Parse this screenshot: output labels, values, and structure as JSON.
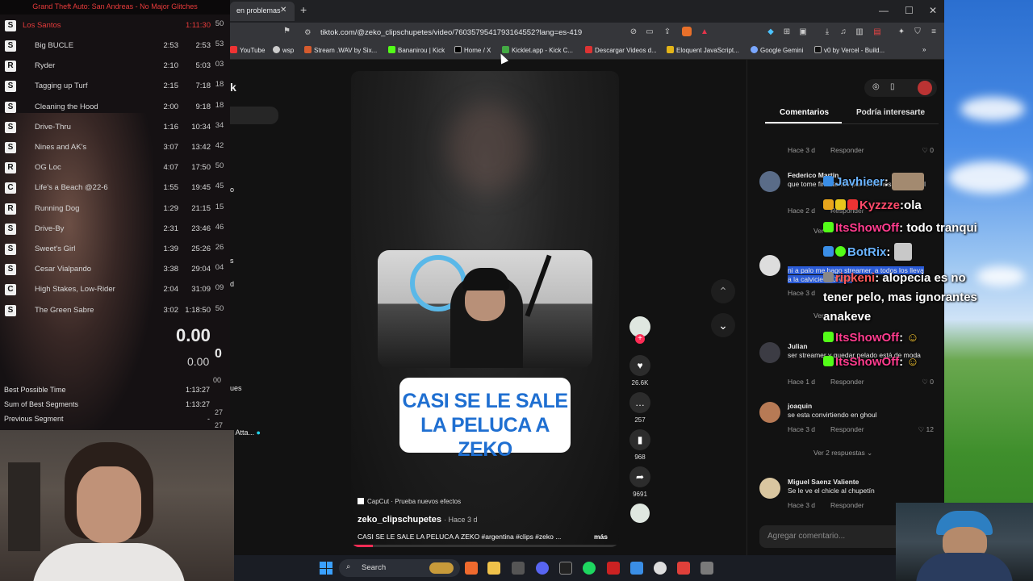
{
  "livesplit": {
    "title": "Grand Theft Auto: San Andreas - No Major Glitches",
    "current": {
      "label": "Los Santos",
      "time": "1:11:30",
      "extra": "50"
    },
    "splits": [
      {
        "icon": "S",
        "name": "Big BUCLE",
        "delta": "2:53",
        "time": "2:53",
        "extra": "53"
      },
      {
        "icon": "R",
        "name": "Ryder",
        "delta": "2:10",
        "time": "5:03",
        "extra": "03"
      },
      {
        "icon": "S",
        "name": "Tagging up Turf",
        "delta": "2:15",
        "time": "7:18",
        "extra": "18"
      },
      {
        "icon": "S",
        "name": "Cleaning the Hood",
        "delta": "2:00",
        "time": "9:18",
        "extra": "18"
      },
      {
        "icon": "S",
        "name": "Drive-Thru",
        "delta": "1:16",
        "time": "10:34",
        "extra": "34"
      },
      {
        "icon": "S",
        "name": "Nines and AK's",
        "delta": "3:07",
        "time": "13:42",
        "extra": "42"
      },
      {
        "icon": "R",
        "name": "OG Loc",
        "delta": "4:07",
        "time": "17:50",
        "extra": "50"
      },
      {
        "icon": "C",
        "name": "Life's a Beach @22-6",
        "delta": "1:55",
        "time": "19:45",
        "extra": "45"
      },
      {
        "icon": "R",
        "name": "Running Dog",
        "delta": "1:29",
        "time": "21:15",
        "extra": "15"
      },
      {
        "icon": "S",
        "name": "Drive-By",
        "delta": "2:31",
        "time": "23:46",
        "extra": "46"
      },
      {
        "icon": "S",
        "name": "Sweet's Girl",
        "delta": "1:39",
        "time": "25:26",
        "extra": "26"
      },
      {
        "icon": "S",
        "name": "Cesar Vialpando",
        "delta": "3:38",
        "time": "29:04",
        "extra": "04"
      },
      {
        "icon": "C",
        "name": "High Stakes, Low-Rider",
        "delta": "2:04",
        "time": "31:09",
        "extra": "09"
      },
      {
        "icon": "S",
        "name": "The Green Sabre",
        "delta": "3:02",
        "time": "1:18:50",
        "extra": "50"
      }
    ],
    "timer_main": "0.00",
    "timer_sub": "0.00",
    "timer_extra": "0",
    "timer_extra2": "00",
    "summary": [
      {
        "label": "Best Possible Time",
        "value": "1:13:27"
      },
      {
        "label": "Sum of Best Segments",
        "value": "1:13:27"
      },
      {
        "label": "Previous Segment",
        "value": "-"
      }
    ],
    "summary_extra": [
      "27",
      "27"
    ]
  },
  "browser": {
    "tab_label": "en problemas",
    "url": "tiktok.com/@zeko_clipschupetes/video/7603579541793164552?lang=es-419",
    "bookmarks": [
      "YouTube",
      "wsp",
      "Stream .WAV by Six...",
      "Bananirou | Kick",
      "Home / X",
      "Kicklet.app - Kick C...",
      "Descargar Videos d...",
      "Eloquent JavaScript...",
      "Google Gemini",
      "v0 by Vercel - Build..."
    ]
  },
  "leftnav_fragments": [
    "k",
    "o",
    "s",
    "d",
    "ues",
    "x Atta...",
    "u"
  ],
  "video": {
    "banner_line1": "CASI SE LE SALE",
    "banner_line2": "LA PELUCA A ZEKO",
    "effect": "CapCut · Prueba nuevos efectos",
    "author": "zeko_clipschupetes",
    "author_time": "· Hace 3 d",
    "caption": "CASI SE LE SALE LA PELUCA A ZEKO #argentina #clips #zeko ...",
    "more": "más",
    "likes": "26.6K",
    "comments": "257",
    "saves": "968",
    "shares": "9691"
  },
  "comments": {
    "tab_comments": "Comentarios",
    "tab_interesting": "Podría interesarte",
    "items": [
      {
        "user": "",
        "text": "",
        "time": "Hace 3 d",
        "reply": "Responder",
        "likes": "0"
      },
      {
        "user": "Federico Martin",
        "text": "que tome finasteride por lo menos o minoxidil",
        "time": "Hace 2 d",
        "reply": "Responder",
        "likes": ""
      },
      {
        "user": "",
        "text": "ni a palo me hago streamer, a todos los lleva a la calvicie JAJAJAJ",
        "time": "Hace 3 d",
        "reply": "",
        "likes": ""
      },
      {
        "user": "Julian",
        "text": "ser streamer y quedar pelado está de moda",
        "time": "Hace 1 d",
        "reply": "Responder",
        "likes": "0"
      },
      {
        "user": "joaquin",
        "text": "se esta convirtiendo en ghoul",
        "time": "Hace 3 d",
        "reply": "Responder",
        "likes": "12"
      },
      {
        "user": "Miguel Saenz Valiente",
        "text": "Se le ve el chicle al chupetín",
        "time": "Hace 3 d",
        "reply": "Responder",
        "likes": ""
      }
    ],
    "view_replies_1": "Ver",
    "view_replies_2": "Ver",
    "view_replies_3": "Ver 2 respuestas",
    "input_placeholder": "Agregar comentario..."
  },
  "chat": [
    {
      "user": "Javhieer",
      "msg": ""
    },
    {
      "user": "Kyzzze",
      "msg": "ola"
    },
    {
      "user": "ItsShowOff",
      "msg": "todo tranqui"
    },
    {
      "user": "BotRix",
      "msg": ""
    },
    {
      "user": "ripkeni",
      "msg": "alopecia es no tener pelo, mas ignorantes anakeve"
    },
    {
      "user": "ItsShowOff",
      "msg": ""
    },
    {
      "user": "ItsShowOff",
      "msg": ""
    }
  ],
  "taskbar": {
    "search_label": "Search"
  }
}
